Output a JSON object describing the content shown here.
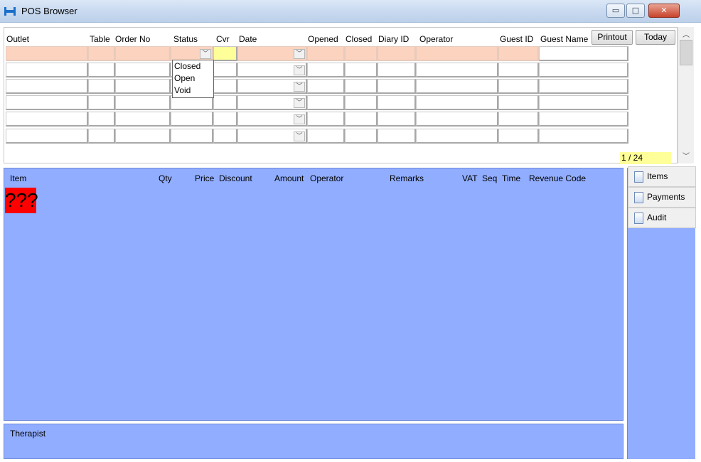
{
  "window": {
    "title": "POS Browser",
    "minimize_glyph": "▭",
    "maximize_glyph": "□",
    "close_glyph": "✕"
  },
  "grid": {
    "headers": {
      "outlet": "Outlet",
      "table": "Table",
      "order_no": "Order No",
      "status": "Status",
      "cvr": "Cvr",
      "date": "Date",
      "opened": "Opened",
      "closed": "Closed",
      "diary_id": "Diary ID",
      "operator": "Operator",
      "guest_id": "Guest ID",
      "guest_name": "Guest Name"
    },
    "printout_label": "Printout",
    "today_label": "Today",
    "status_options": [
      "Closed",
      "Open",
      "Void"
    ],
    "page_indicator": "1 / 24"
  },
  "detail": {
    "headers": {
      "item": "Item",
      "qty": "Qty",
      "price": "Price",
      "discount": "Discount",
      "amount": "Amount",
      "operator": "Operator",
      "remarks": "Remarks",
      "vat": "VAT",
      "seq": "Seq",
      "time": "Time",
      "revenue_code": "Revenue Code"
    },
    "missing_marker": "???",
    "therapist_label": "Therapist"
  },
  "tabs": [
    {
      "label": "Items",
      "icon": "search-icon"
    },
    {
      "label": "Payments",
      "icon": "document-icon"
    },
    {
      "label": "Audit",
      "icon": "document-icon"
    }
  ],
  "colors": {
    "filter_row": "#fbd3bf",
    "cvr_highlight": "#ffff99",
    "detail_bg": "#91adff"
  }
}
